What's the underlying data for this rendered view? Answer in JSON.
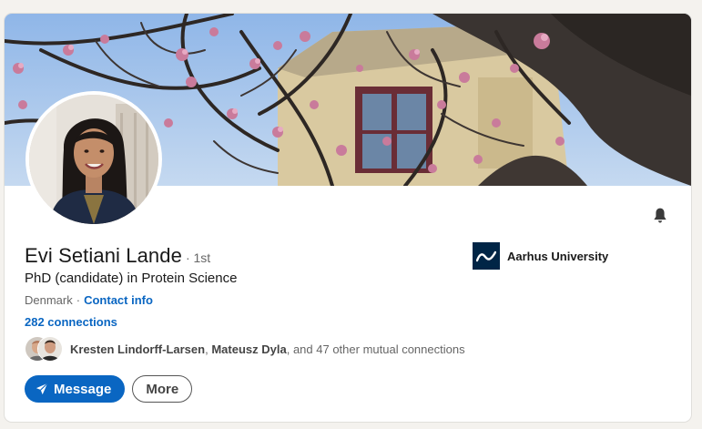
{
  "profile": {
    "name": "Evi Setiani Lande",
    "degree": "· 1st",
    "headline": "PhD (candidate) in Protein Science",
    "location": "Denmark",
    "separator": "·",
    "contact_info": "Contact info",
    "connections": "282 connections"
  },
  "mutual": {
    "name1": "Kresten Lindorff-Larsen",
    "comma": ",",
    "name2": "Mateusz Dyla",
    "rest": "and 47 other mutual connections"
  },
  "actions": {
    "message_label": "Message",
    "more_label": "More"
  },
  "organization": {
    "name": "Aarhus University"
  },
  "icons": {
    "bell": "bell-icon",
    "send": "send-icon",
    "org_logo": "aarhus-university-logo"
  },
  "colors": {
    "accent": "#0a66c2",
    "text": "#191919",
    "muted": "#666666",
    "org_logo_bg": "#002546"
  }
}
